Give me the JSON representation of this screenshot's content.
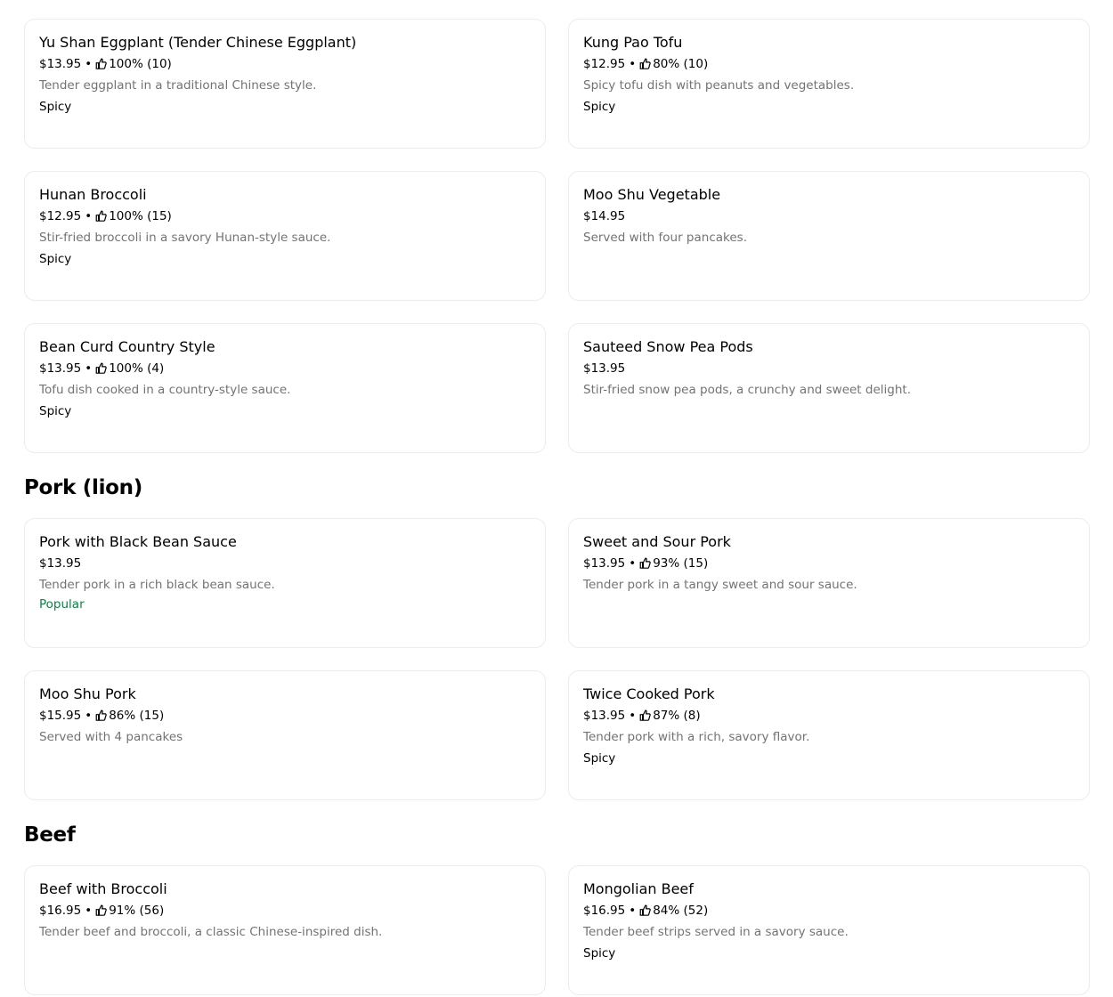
{
  "sections": [
    {
      "heading": "",
      "items": [
        {
          "name": "Yu Shan Eggplant (Tender Chinese Eggplant)",
          "price": "$13.95",
          "rating": "100% (10)",
          "description": "Tender eggplant in a traditional Chinese style.",
          "tag": "Spicy"
        },
        {
          "name": "Kung Pao Tofu",
          "price": "$12.95",
          "rating": "80% (10)",
          "description": "Spicy tofu dish with peanuts and vegetables.",
          "tag": "Spicy"
        },
        {
          "name": "Hunan Broccoli",
          "price": "$12.95",
          "rating": "100% (15)",
          "description": "Stir-fried broccoli in a savory Hunan-style sauce.",
          "tag": "Spicy"
        },
        {
          "name": "Moo Shu Vegetable",
          "price": "$14.95",
          "rating": "",
          "description": "Served with four pancakes.",
          "tag": ""
        },
        {
          "name": "Bean Curd Country Style",
          "price": "$13.95",
          "rating": "100% (4)",
          "description": "Tofu dish cooked in a country-style sauce.",
          "tag": "Spicy"
        },
        {
          "name": "Sauteed Snow Pea Pods",
          "price": "$13.95",
          "rating": "",
          "description": "Stir-fried snow pea pods, a crunchy and sweet delight.",
          "tag": ""
        }
      ]
    },
    {
      "heading": "Pork (lion)",
      "items": [
        {
          "name": "Pork with Black Bean Sauce",
          "price": "$13.95",
          "rating": "",
          "description": "Tender pork in a rich black bean sauce.",
          "tag": "Popular"
        },
        {
          "name": "Sweet and Sour Pork",
          "price": "$13.95",
          "rating": "93% (15)",
          "description": "Tender pork in a tangy sweet and sour sauce.",
          "tag": ""
        },
        {
          "name": "Moo Shu Pork",
          "price": "$15.95",
          "rating": "86% (15)",
          "description": "Served with 4 pancakes",
          "tag": ""
        },
        {
          "name": "Twice Cooked Pork",
          "price": "$13.95",
          "rating": "87% (8)",
          "description": "Tender pork with a rich, savory flavor.",
          "tag": "Spicy"
        }
      ]
    },
    {
      "heading": "Beef",
      "items": [
        {
          "name": "Beef with Broccoli",
          "price": "$16.95",
          "rating": "91% (56)",
          "description": "Tender beef and broccoli, a classic Chinese-inspired dish.",
          "tag": ""
        },
        {
          "name": "Mongolian Beef",
          "price": "$16.95",
          "rating": "84% (52)",
          "description": "Tender beef strips served in a savory sauce.",
          "tag": "Spicy"
        }
      ]
    }
  ],
  "icons": {
    "rating": "thumbs-up-icon"
  },
  "colors": {
    "popular": "#0e8345",
    "description": "#737373",
    "card_border": "#ececec"
  }
}
